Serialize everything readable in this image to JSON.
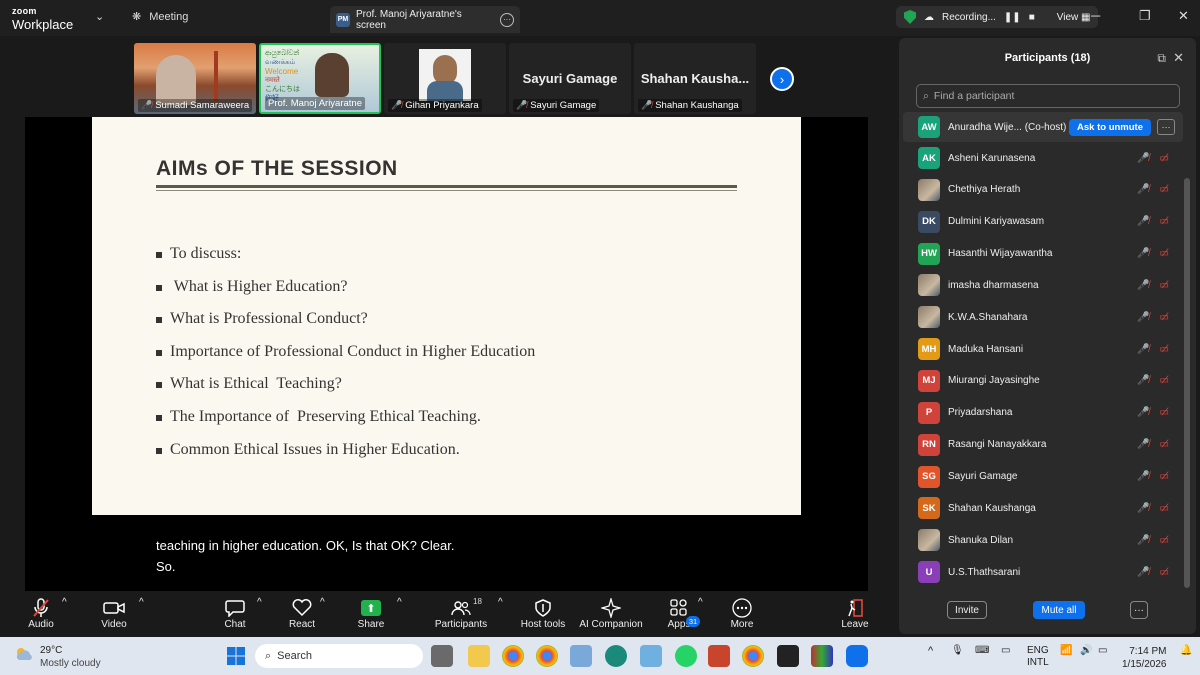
{
  "titlebar": {
    "brand_top": "zoom",
    "brand_bottom": "Workplace",
    "meeting_tab": "Meeting",
    "share_tab_badge": "PM",
    "share_tab_title": "Prof. Manoj Ariyaratne's screen",
    "recording_label": "Recording...",
    "view_label": "View"
  },
  "video_strip": [
    {
      "name": "Sumadi Samaraweera",
      "big_name": ""
    },
    {
      "name": "Prof. Manoj Ariyaratne",
      "big_name": ""
    },
    {
      "name": "Gihan Priyankara",
      "big_name": ""
    },
    {
      "name": "Sayuri Gamage",
      "big_name": "Sayuri Gamage"
    },
    {
      "name": "Shahan Kaushanga",
      "big_name": "Shahan Kausha..."
    }
  ],
  "slide": {
    "title": "AIMs OF THE SESSION",
    "bullets": [
      "To discuss:",
      " What is Higher Education?",
      "What is Professional Conduct?",
      "Importance of Professional Conduct in Higher Education",
      "What is Ethical  Teaching?",
      "The Importance of  Preserving Ethical Teaching.",
      "Common Ethical Issues in Higher Education."
    ]
  },
  "captions": [
    "teaching in higher education. OK, Is that OK? Clear.",
    "So."
  ],
  "toolbar": {
    "audio": "Audio",
    "video": "Video",
    "chat": "Chat",
    "react": "React",
    "share": "Share",
    "participants": "Participants",
    "participants_count": "18",
    "host_tools": "Host tools",
    "ai_companion": "AI Companion",
    "apps": "Apps",
    "apps_badge": "31",
    "more": "More",
    "leave": "Leave"
  },
  "panel": {
    "title": "Participants (18)",
    "search_placeholder": "Find a participant",
    "cohost_name": "Anuradha Wije...  (Co-host)",
    "cohost_initials": "AW",
    "ask_to_unmute": "Ask to unmute",
    "participants": [
      {
        "initials": "AK",
        "name": "Asheni Karunasena",
        "color": "#1aa37a"
      },
      {
        "initials": "",
        "name": "Chethiya Herath",
        "color": "photo"
      },
      {
        "initials": "DK",
        "name": "Dulmini Kariyawasam",
        "color": "#3b4a63"
      },
      {
        "initials": "HW",
        "name": "Hasanthi Wijayawantha",
        "color": "#23a455"
      },
      {
        "initials": "",
        "name": "imasha dharmasena",
        "color": "photo"
      },
      {
        "initials": "",
        "name": "K.W.A.Shanahara",
        "color": "photo"
      },
      {
        "initials": "MH",
        "name": "Maduka Hansani",
        "color": "#e39a16"
      },
      {
        "initials": "MJ",
        "name": "Miurangi Jayasinghe",
        "color": "#d0433a"
      },
      {
        "initials": "P",
        "name": "Priyadarshana",
        "color": "#d0433a"
      },
      {
        "initials": "RN",
        "name": "Rasangi Nanayakkara",
        "color": "#d0433a"
      },
      {
        "initials": "SG",
        "name": "Sayuri Gamage",
        "color": "#e0552c"
      },
      {
        "initials": "SK",
        "name": "Shahan Kaushanga",
        "color": "#d4691c"
      },
      {
        "initials": "",
        "name": "Shanuka Dilan",
        "color": "photo"
      },
      {
        "initials": "U",
        "name": "U.S.Thathsarani",
        "color": "#8a3fb8"
      }
    ],
    "invite": "Invite",
    "mute_all": "Mute all",
    "cohost_color": "#1aa37a"
  },
  "taskbar": {
    "temp": "29°C",
    "weather": "Mostly cloudy",
    "search": "Search",
    "lang1": "ENG",
    "lang2": "INTL",
    "time": "7:14 PM",
    "date": "1/15/2026"
  }
}
